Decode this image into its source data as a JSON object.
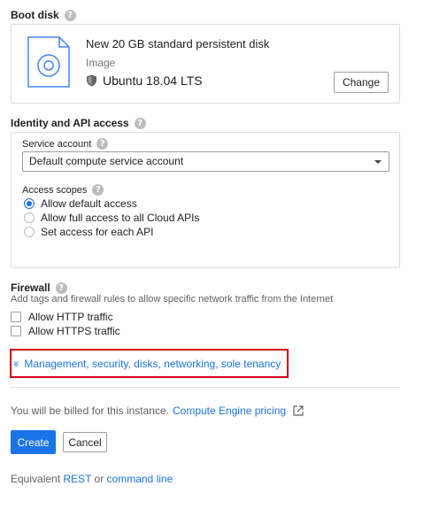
{
  "boot_disk": {
    "label": "Boot disk",
    "disk_title": "New 20 GB standard persistent disk",
    "image_label": "Image",
    "os_name": "Ubuntu 18.04 LTS",
    "change_label": "Change"
  },
  "identity": {
    "label": "Identity and API access",
    "service_account_label": "Service account",
    "service_account_value": "Default compute service account",
    "access_scopes_label": "Access scopes",
    "scopes": [
      {
        "label": "Allow default access",
        "checked": true
      },
      {
        "label": "Allow full access to all Cloud APIs",
        "checked": false
      },
      {
        "label": "Set access for each API",
        "checked": false
      }
    ]
  },
  "firewall": {
    "label": "Firewall",
    "description": "Add tags and firewall rules to allow specific network traffic from the Internet",
    "options": [
      {
        "label": "Allow HTTP traffic",
        "checked": false
      },
      {
        "label": "Allow HTTPS traffic",
        "checked": false
      }
    ]
  },
  "management": {
    "chevron": "»",
    "link_text": "Management, security, disks, networking, sole tenancy"
  },
  "billing": {
    "text": "You will be billed for this instance.",
    "link_text": "Compute Engine pricing"
  },
  "actions": {
    "create_label": "Create",
    "cancel_label": "Cancel"
  },
  "equivalent": {
    "prefix": "Equivalent",
    "rest_link": "REST",
    "or_text": "or",
    "cmd_link": "command line"
  },
  "help_glyph": "?",
  "colors": {
    "accent": "#1a73e8",
    "highlight_border": "#d0021b"
  }
}
